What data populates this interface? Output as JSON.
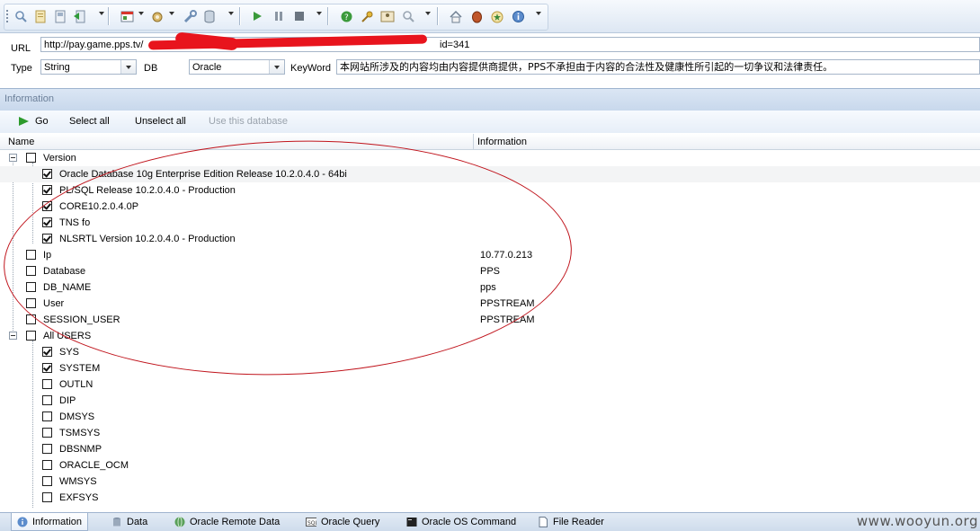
{
  "toolbar": {
    "icons": [
      "search-icon",
      "open-icon",
      "save-icon",
      "export-icon",
      "dropdown",
      "browser-icon",
      "dropdown",
      "tools-icon",
      "dropdown",
      "wrench-icon",
      "database-icon",
      "dropdown",
      "play-icon",
      "pause-icon",
      "stop-icon",
      "dropdown",
      "help-icon",
      "key-icon",
      "user-icon",
      "zoom-icon",
      "dropdown",
      "home-icon",
      "bug-icon",
      "star-icon",
      "info-icon",
      "dropdown"
    ]
  },
  "params": {
    "url_label": "URL",
    "url_value": "http://pay.game.pps.tv/",
    "url_tail": "id=341",
    "type_label": "Type",
    "type_value": "String",
    "db_label": "DB",
    "db_value": "Oracle",
    "keyword_label": "KeyWord",
    "keyword_value": "本网站所涉及的内容均由内容提供商提供，PPS不承担由于内容的合法性及健康性所引起的一切争议和法律责任。"
  },
  "panel": {
    "title": "Information",
    "actions": {
      "go": "Go",
      "select_all": "Select all",
      "unselect_all": "Unselect all",
      "use_db": "Use this database"
    },
    "columns": {
      "name": "Name",
      "info": "Information"
    }
  },
  "tree": {
    "version": {
      "label": "Version",
      "children": [
        "Oracle Database 10g Enterprise Edition Release 10.2.0.4.0 - 64bi",
        "PL/SQL Release 10.2.0.4.0 - Production",
        "CORE10.2.0.4.0P",
        "TNS fo",
        "NLSRTL Version 10.2.0.4.0 - Production"
      ]
    },
    "ip": {
      "label": "Ip",
      "value": "10.77.0.213"
    },
    "database": {
      "label": "Database",
      "value": "PPS"
    },
    "db_name": {
      "label": "DB_NAME",
      "value": "pps"
    },
    "user": {
      "label": "User",
      "value": "PPSTREAM"
    },
    "session_user": {
      "label": "SESSION_USER",
      "value": "PPSTREAM"
    },
    "all_users": {
      "label": "All USERS",
      "children": [
        {
          "name": "SYS",
          "checked": true
        },
        {
          "name": "SYSTEM",
          "checked": true
        },
        {
          "name": "OUTLN",
          "checked": false
        },
        {
          "name": "DIP",
          "checked": false
        },
        {
          "name": "DMSYS",
          "checked": false
        },
        {
          "name": "TSMSYS",
          "checked": false
        },
        {
          "name": "DBSNMP",
          "checked": false
        },
        {
          "name": "ORACLE_OCM",
          "checked": false
        },
        {
          "name": "WMSYS",
          "checked": false
        },
        {
          "name": "EXFSYS",
          "checked": false
        }
      ]
    }
  },
  "tabs": [
    {
      "label": "Information",
      "icon": "info-icon",
      "active": true
    },
    {
      "label": "Data",
      "icon": "database-icon",
      "active": false
    },
    {
      "label": "Oracle Remote Data",
      "icon": "globe-icon",
      "active": false
    },
    {
      "label": "Oracle Query",
      "icon": "sql-icon",
      "active": false
    },
    {
      "label": "Oracle OS Command",
      "icon": "console-icon",
      "active": false
    },
    {
      "label": "File Reader",
      "icon": "file-icon",
      "active": false
    }
  ],
  "watermark": "www.wooyun.org",
  "colors": {
    "accent": "#dbe6f4",
    "annotation": "#c0141c",
    "redaction": "#e8141d"
  }
}
